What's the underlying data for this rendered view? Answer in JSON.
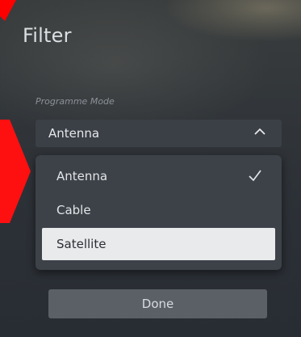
{
  "dialog": {
    "title": "Filter"
  },
  "programme_mode": {
    "label": "Programme Mode",
    "selected_value": "Antenna",
    "options": [
      {
        "label": "Antenna",
        "checked": true,
        "focused": false
      },
      {
        "label": "Cable",
        "checked": false,
        "focused": false
      },
      {
        "label": "Satellite",
        "checked": false,
        "focused": true
      }
    ]
  },
  "actions": {
    "done_label": "Done"
  },
  "icons": {
    "select_chevron": "chevron-up-icon",
    "checked_option": "checkmark-icon"
  },
  "colors": {
    "panel_text": "#dcdfe3",
    "select_bg": "#3b3f46",
    "dropdown_bg": "#3d4249",
    "focused_option_bg": "#e9eaec",
    "done_button_bg": "#5b6067",
    "annotation_arrow": "#ff0000"
  }
}
